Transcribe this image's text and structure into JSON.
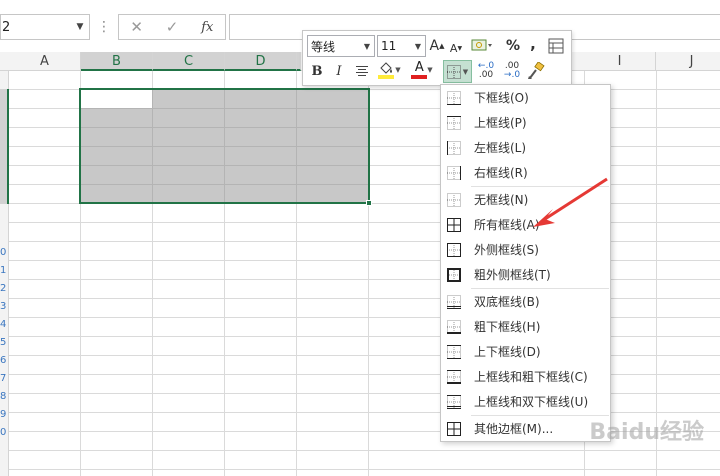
{
  "namebox": {
    "value": "2"
  },
  "formula_bar": {
    "cancel_icon": "✕",
    "enter_icon": "✓",
    "fx_label": "fx",
    "separator": "⋮",
    "value": ""
  },
  "columns": [
    "A",
    "B",
    "C",
    "D",
    "",
    "I",
    "J"
  ],
  "selected_columns": [
    "B",
    "C",
    "D"
  ],
  "row_numbers": [
    "0",
    "1",
    "2",
    "3",
    "4",
    "5",
    "6",
    "7",
    "8",
    "9",
    "0"
  ],
  "mini_toolbar": {
    "font": "等线",
    "size": "11",
    "grow_font": "A",
    "shrink_font": "A",
    "percent": "%",
    "comma": ",",
    "bold": "B",
    "italic": "I",
    "font_color_letter": "A",
    "inc_decimal": "←.0",
    "inc_decimal_sub": ".00",
    "dec_decimal": ".00",
    "dec_decimal_sub": "→.0",
    "fill_color": "#ffeb3b",
    "font_color": "#e02020"
  },
  "border_menu": {
    "items": [
      {
        "label": "下框线(O)",
        "icon": "border-bottom-icon"
      },
      {
        "label": "上框线(P)",
        "icon": "border-top-icon"
      },
      {
        "label": "左框线(L)",
        "icon": "border-left-icon"
      },
      {
        "label": "右框线(R)",
        "icon": "border-right-icon"
      },
      {
        "label": "无框线(N)",
        "icon": "no-border-icon"
      },
      {
        "label": "所有框线(A)",
        "icon": "all-borders-icon"
      },
      {
        "label": "外侧框线(S)",
        "icon": "outside-borders-icon"
      },
      {
        "label": "粗外侧框线(T)",
        "icon": "thick-outside-borders-icon"
      },
      {
        "label": "双底框线(B)",
        "icon": "double-bottom-border-icon"
      },
      {
        "label": "粗下框线(H)",
        "icon": "thick-bottom-border-icon"
      },
      {
        "label": "上下框线(D)",
        "icon": "top-bottom-border-icon"
      },
      {
        "label": "上框线和粗下框线(C)",
        "icon": "top-thick-bottom-border-icon"
      },
      {
        "label": "上框线和双下框线(U)",
        "icon": "top-double-bottom-border-icon"
      },
      {
        "label": "其他边框(M)...",
        "icon": "more-borders-icon"
      }
    ]
  },
  "watermark": "Baidu经验",
  "colors": {
    "accent": "#217346",
    "arrow": "#e53935",
    "selection": "#c8c8c8"
  }
}
